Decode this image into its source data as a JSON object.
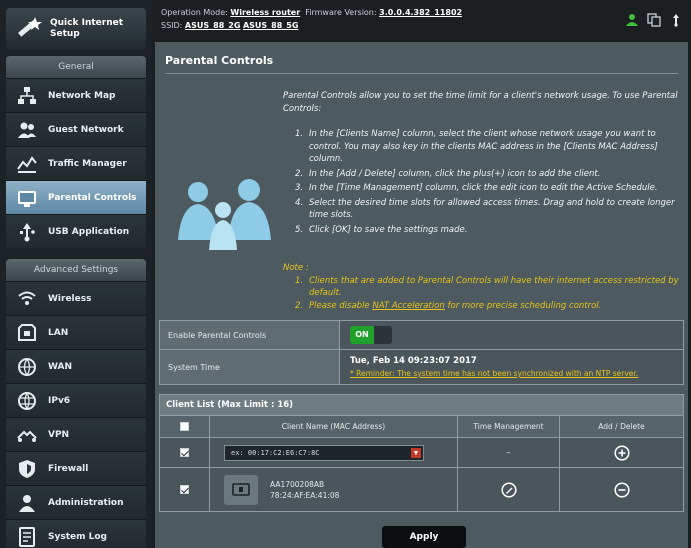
{
  "sidebar": {
    "qis": {
      "label": "Quick Internet\nSetup",
      "icon": "wand-icon"
    },
    "general_title": "General",
    "general_items": [
      {
        "label": "Network Map",
        "icon": "network-map-icon",
        "active": false
      },
      {
        "label": "Guest Network",
        "icon": "guest-network-icon",
        "active": false
      },
      {
        "label": "Traffic Manager",
        "icon": "traffic-manager-icon",
        "active": false
      },
      {
        "label": "Parental Controls",
        "icon": "parental-controls-icon",
        "active": true
      },
      {
        "label": "USB Application",
        "icon": "usb-application-icon",
        "active": false
      }
    ],
    "advanced_title": "Advanced Settings",
    "advanced_items": [
      {
        "label": "Wireless",
        "icon": "wireless-icon"
      },
      {
        "label": "LAN",
        "icon": "lan-icon"
      },
      {
        "label": "WAN",
        "icon": "wan-icon"
      },
      {
        "label": "IPv6",
        "icon": "ipv6-icon"
      },
      {
        "label": "VPN",
        "icon": "vpn-icon"
      },
      {
        "label": "Firewall",
        "icon": "firewall-icon"
      },
      {
        "label": "Administration",
        "icon": "administration-icon"
      },
      {
        "label": "System Log",
        "icon": "system-log-icon"
      }
    ]
  },
  "topbar": {
    "op_mode_label": "Operation Mode:",
    "op_mode_value": "Wireless router",
    "fw_label": "Firmware Version:",
    "fw_value": "3.0.0.4.382_11802",
    "ssid_label": "SSID:",
    "ssid_2g": "ASUS_88_2G",
    "ssid_5g": "ASUS_88_5G",
    "icons": [
      "user-icon",
      "copy-icon",
      "usb-icon"
    ]
  },
  "main": {
    "title": "Parental Controls",
    "intro": "Parental Controls allow you to set the time limit for a client's network usage. To use Parental Controls:",
    "steps": [
      "In the [Clients Name] column, select the client whose network usage you want to control. You may also key in the clients MAC address in the [Clients MAC Address] column.",
      "In the [Add / Delete] column, click the plus(+) icon to add the client.",
      "In the [Time Management] column, click the edit icon to edit the Active Schedule.",
      "Select the desired time slots for allowed access times. Drag and hold to create longer time slots.",
      "Click [OK] to save the settings made."
    ],
    "note_title": "Note :",
    "notes": [
      "Clients that are added to Parental Controls will have their internet access restricted by default.",
      "Please disable NAT Acceleration for more precise scheduling control."
    ],
    "note_link": "NAT Acceleration",
    "enable_label": "Enable Parental Controls",
    "toggle_text": "ON",
    "system_time_label": "System Time",
    "system_time_value": "Tue, Feb 14 09:23:07 2017",
    "system_time_warning": "* Reminder: The system time has not been synchronized with an NTP server.",
    "client_list": {
      "title": "Client List (Max Limit : 16)",
      "headers": [
        "Client Name (MAC Address)",
        "Time Management",
        "Add / Delete"
      ],
      "mac_placeholder": "ex: 00:17:C2:E6:C7:8C",
      "dash": "–",
      "client_name": "AA1700208AB",
      "client_mac": "78:24:AF:EA:41:08"
    },
    "apply_label": "Apply"
  },
  "colors": {
    "accent_active": "#5d87a3",
    "toggle_on": "#1fa12b",
    "note": "#e9c317"
  }
}
